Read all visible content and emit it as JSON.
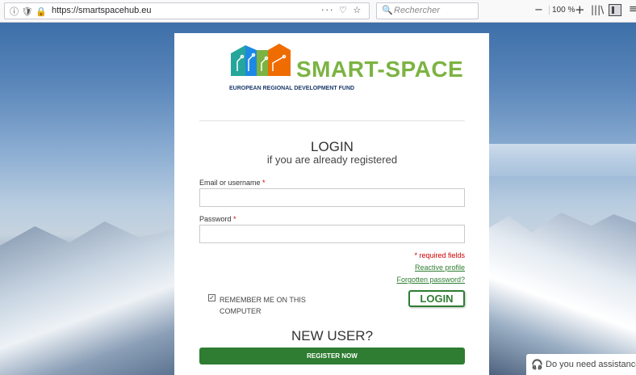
{
  "browser": {
    "url": "https://smartspacehub.eu",
    "url_icons": "ⓘ 🛡",
    "url_actions": "··· ♡ ☆",
    "search_placeholder": "Rechercher",
    "zoom": "100 %"
  },
  "brand": {
    "name": "SMART-SPACE",
    "fund": "EUROPEAN REGIONAL DEVELOPMENT FUND",
    "colors": {
      "green": "#7cb342",
      "teal": "#26a69a",
      "blue": "#1e88e5",
      "orange": "#ef6c00"
    }
  },
  "login": {
    "title": "LOGIN",
    "subtitle": "if you are already registered",
    "email_label": "Email or username",
    "password_label": "Password",
    "required_star": "*",
    "email_value": "",
    "password_value": "",
    "required_note": "* required fields",
    "reactivate_link": "Reactive profile",
    "forgot_link": "Forgotten password?",
    "remember_label": "REMEMBER ME ON THIS COMPUTER",
    "remember_checked": true,
    "button": "LOGIN"
  },
  "register": {
    "title": "NEW USER?",
    "button": "REGISTER NOW"
  },
  "assist": {
    "text": "Do you need assistance"
  },
  "colors": {
    "primary_green": "#2e7d32",
    "required_red": "#cc0000"
  }
}
